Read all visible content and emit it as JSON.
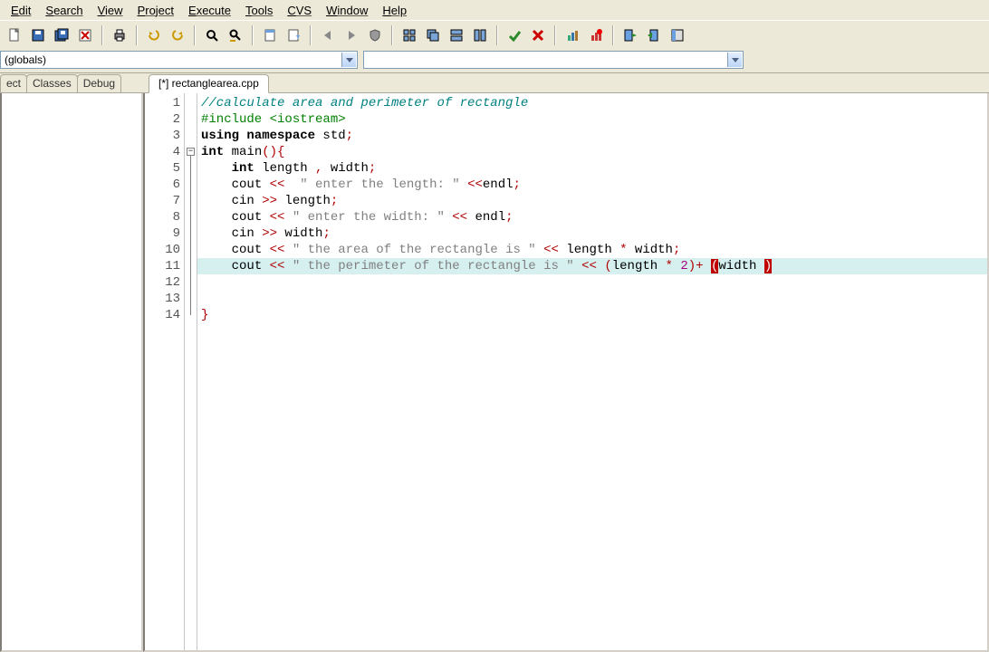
{
  "menu": [
    "Edit",
    "Search",
    "View",
    "Project",
    "Execute",
    "Tools",
    "CVS",
    "Window",
    "Help"
  ],
  "toolbar_icons": [
    "new-file",
    "save",
    "save-all",
    "close",
    "",
    "print",
    "",
    "undo",
    "redo",
    "",
    "find",
    "replace",
    "",
    "toggle-bookmark",
    "goto-bookmark",
    "",
    "nav-back",
    "nav-forward",
    "shield",
    "",
    "window-tile",
    "window-cascade",
    "window-horz",
    "window-vert",
    "",
    "check",
    "cancel",
    "",
    "chart-bar",
    "chart-red",
    "",
    "exit",
    "insert",
    "panel"
  ],
  "combo1_text": "(globals)",
  "combo2_text": "",
  "side_tabs": [
    "ect",
    "Classes",
    "Debug"
  ],
  "file_tab": "[*] rectanglearea.cpp",
  "lines": [
    {
      "n": 1,
      "type": "comment",
      "text": "//calculate area and perimeter of rectangle"
    },
    {
      "n": 2,
      "type": "include",
      "text": "#include <iostream>"
    },
    {
      "n": 3,
      "type": "using",
      "text": "using namespace std;"
    },
    {
      "n": 4,
      "type": "main",
      "text": "int main(){"
    },
    {
      "n": 5,
      "type": "decl",
      "text": "    int length , width;"
    },
    {
      "n": 6,
      "type": "cout",
      "text": "    cout <<  \" enter the length: \" <<endl;"
    },
    {
      "n": 7,
      "type": "cin",
      "text": "    cin >> length;"
    },
    {
      "n": 8,
      "type": "cout",
      "text": "    cout << \" enter the width: \" << endl;"
    },
    {
      "n": 9,
      "type": "cin",
      "text": "    cin >> width;"
    },
    {
      "n": 10,
      "type": "cout",
      "text": "    cout << \" the area of the rectangle is \" << length * width;"
    },
    {
      "n": 11,
      "type": "cout-hl",
      "text": "    cout << \" the perimeter of the rectangle is \" << (length * 2)+ (width )"
    },
    {
      "n": 12,
      "type": "blank",
      "text": ""
    },
    {
      "n": 13,
      "type": "blank",
      "text": ""
    },
    {
      "n": 14,
      "type": "close",
      "text": "}"
    }
  ],
  "highlight_line": 11,
  "fold_at": 4
}
